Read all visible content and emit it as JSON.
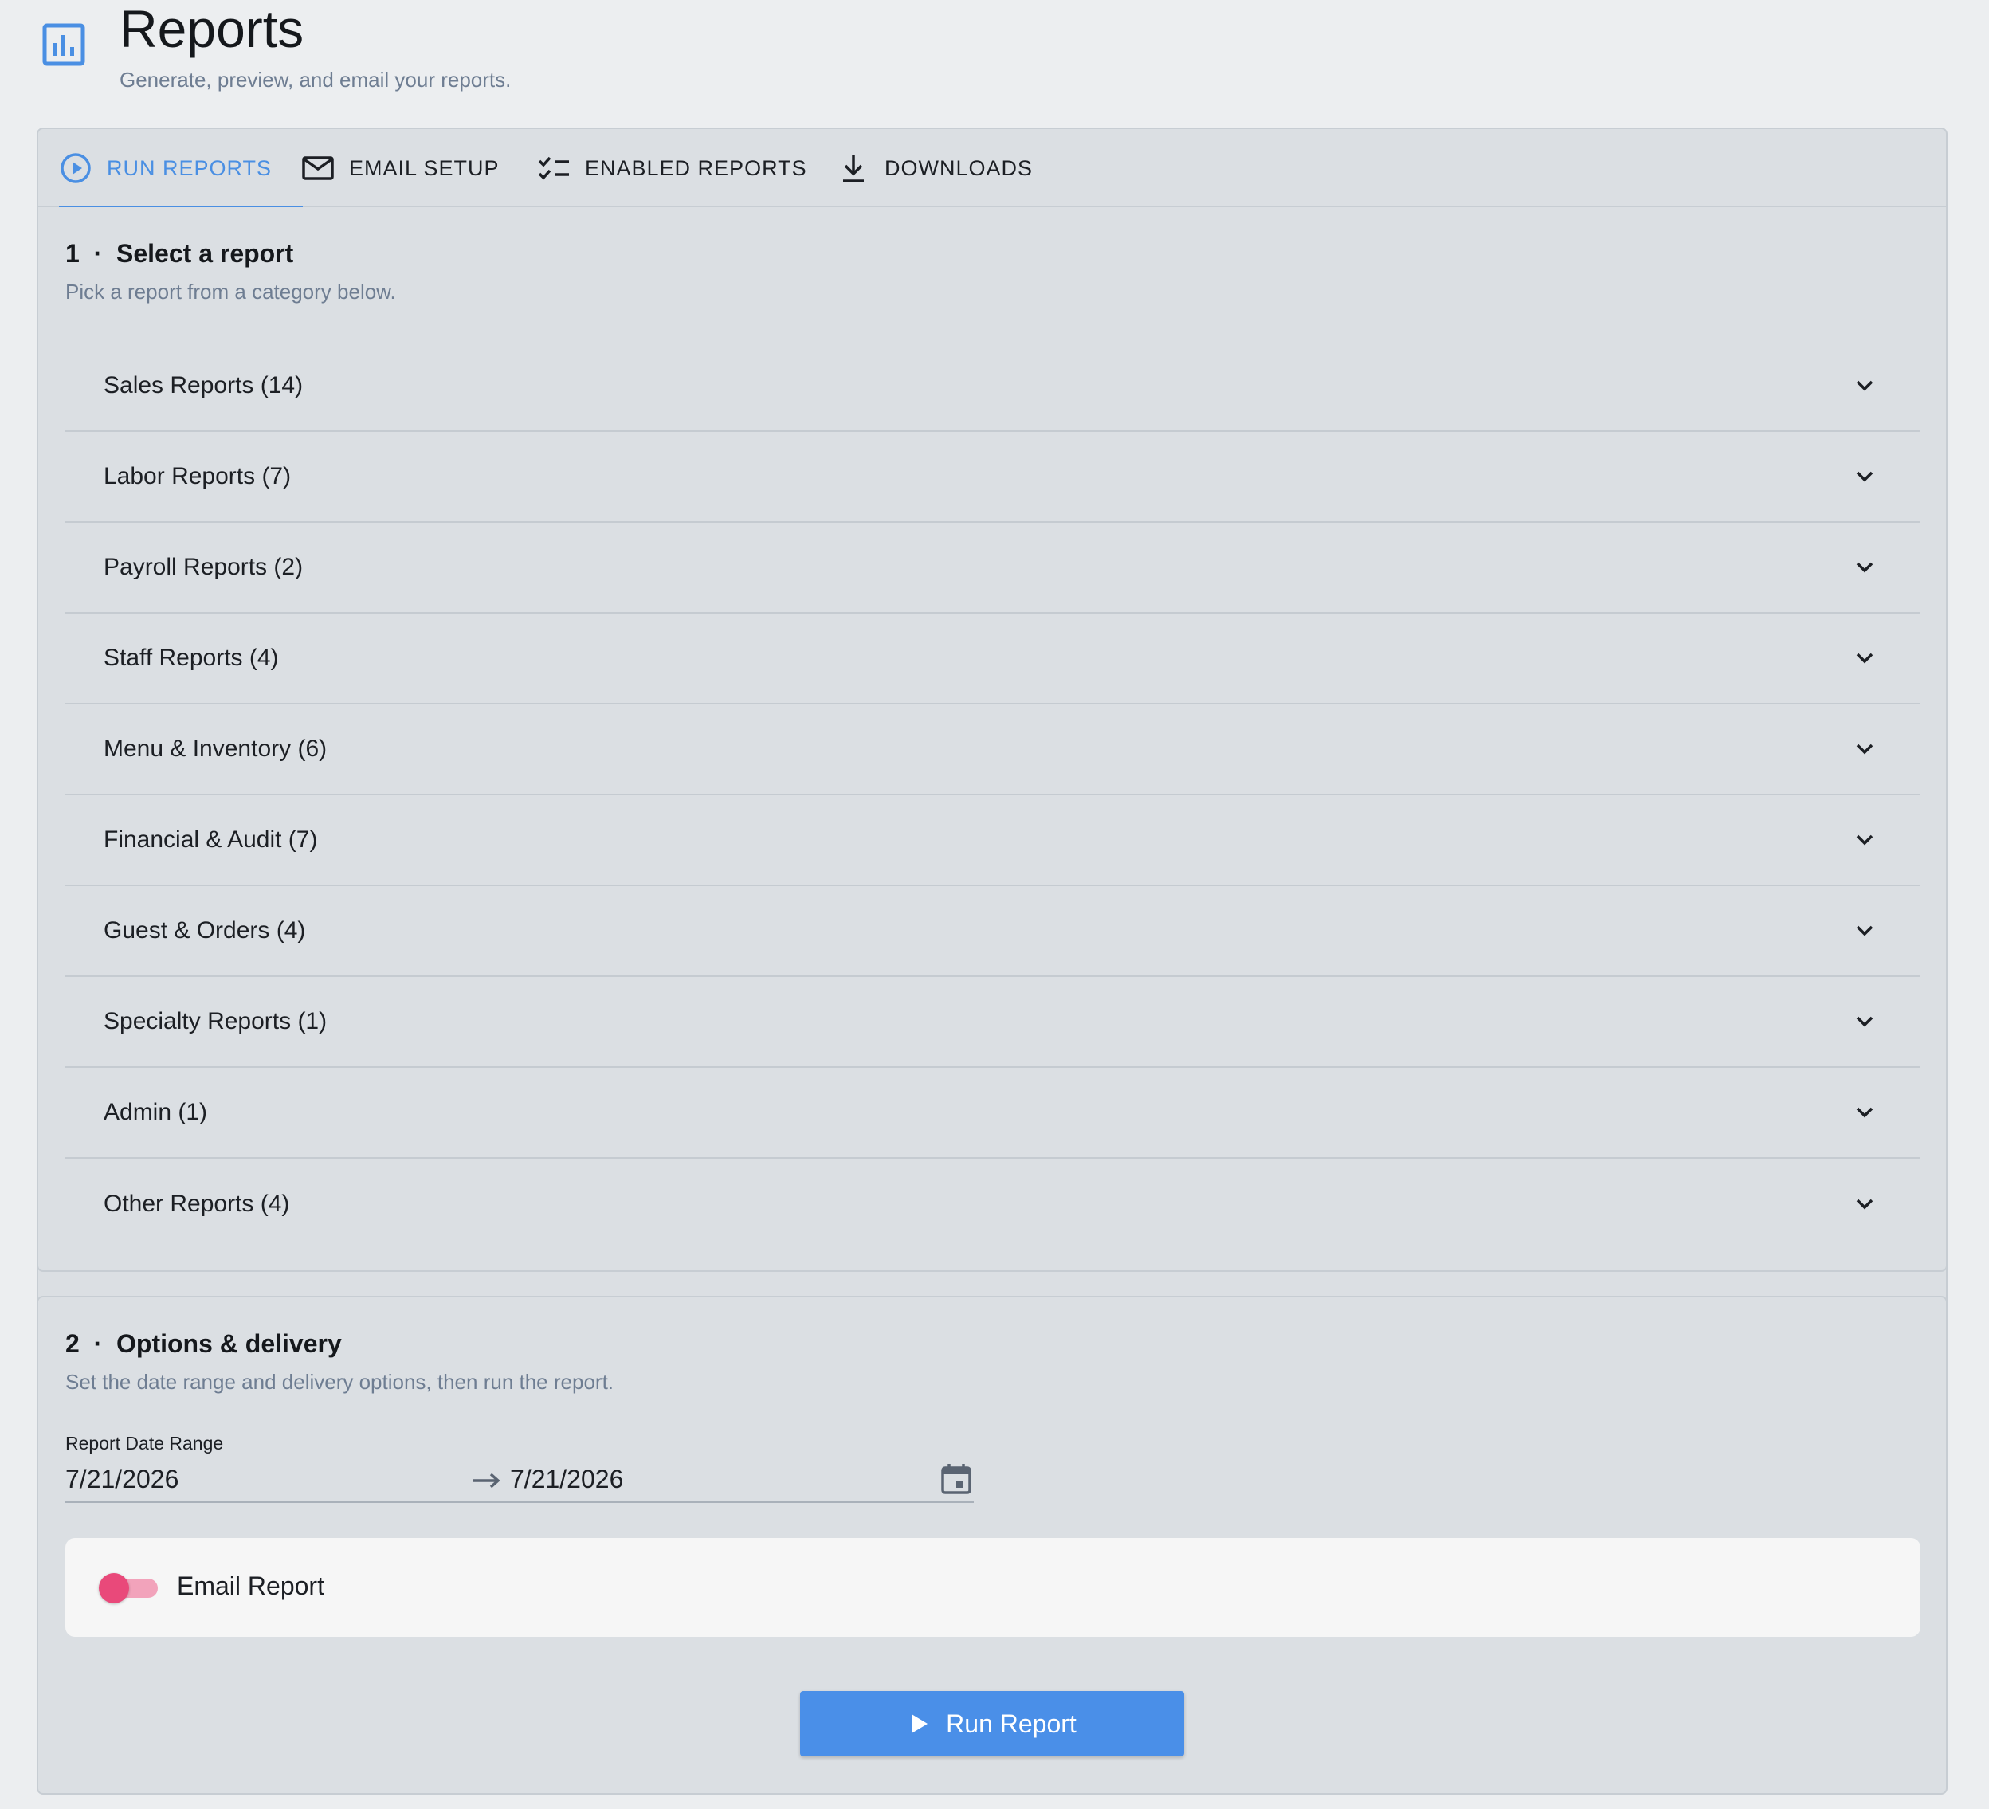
{
  "header": {
    "title": "Reports",
    "subtitle": "Generate, preview, and email your reports.",
    "icon": "bar-chart-icon"
  },
  "tabs": [
    {
      "label": "RUN REPORTS",
      "icon": "play-circle-icon",
      "active": true
    },
    {
      "label": "EMAIL SETUP",
      "icon": "mail-icon",
      "active": false
    },
    {
      "label": "ENABLED REPORTS",
      "icon": "checklist-icon",
      "active": false
    },
    {
      "label": "DOWNLOADS",
      "icon": "download-icon",
      "active": false
    }
  ],
  "step1": {
    "number": "1",
    "title": "Select a report",
    "description": "Pick a report from a category below.",
    "categories": [
      {
        "label": "Sales Reports (14)"
      },
      {
        "label": "Labor Reports (7)"
      },
      {
        "label": "Payroll Reports (2)"
      },
      {
        "label": "Staff Reports (4)"
      },
      {
        "label": "Menu & Inventory (6)"
      },
      {
        "label": "Financial & Audit (7)"
      },
      {
        "label": "Guest & Orders (4)"
      },
      {
        "label": "Specialty Reports (1)"
      },
      {
        "label": "Admin (1)"
      },
      {
        "label": "Other Reports (4)"
      }
    ]
  },
  "step2": {
    "number": "2",
    "title": "Options & delivery",
    "description": "Set the date range and delivery options, then run the report.",
    "date_range": {
      "label": "Report Date Range",
      "start": "7/21/2026",
      "end": "7/21/2026"
    },
    "email_report": {
      "label": "Email Report",
      "enabled": false
    },
    "run_button_label": "Run Report"
  },
  "colors": {
    "accent": "#4a8fe3",
    "toggle": "#e9497a",
    "background": "#eceef0",
    "card": "#dbdfe3"
  }
}
